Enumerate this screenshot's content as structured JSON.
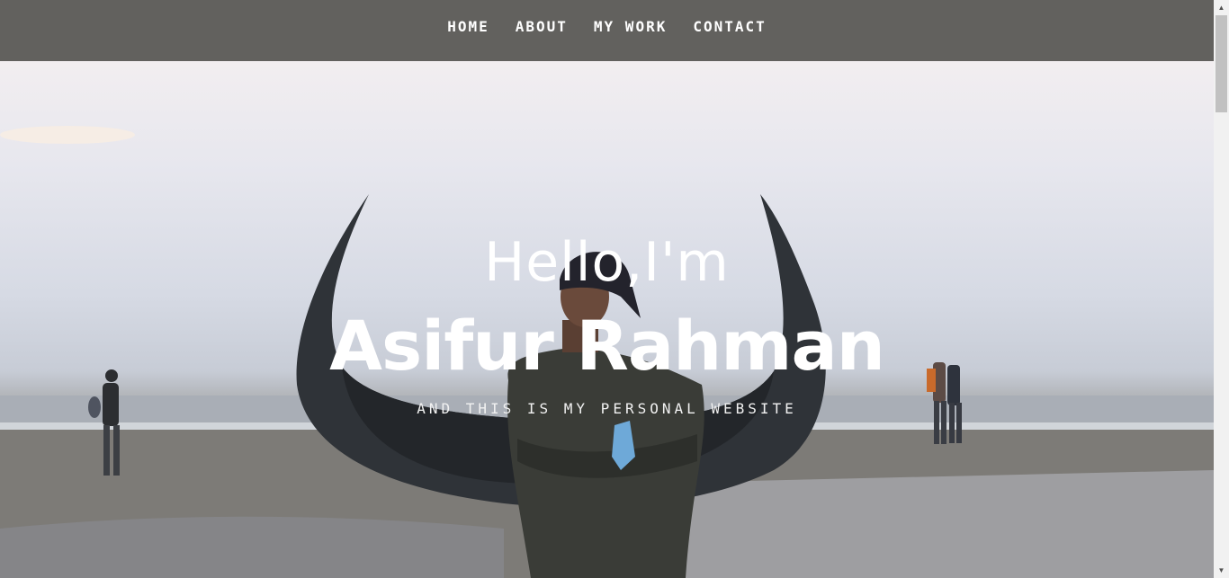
{
  "nav": {
    "items": [
      {
        "label": "HOME"
      },
      {
        "label": "ABOUT"
      },
      {
        "label": "MY WORK"
      },
      {
        "label": "CONTACT"
      }
    ]
  },
  "hero": {
    "greeting": "Hello,I'm",
    "name": "Asifur Rahman",
    "tagline": "AND THIS IS MY PERSONAL WEBSITE",
    "background": "beach-boat-portrait-photo"
  },
  "colors": {
    "navbar": "#62615e",
    "text": "#ffffff"
  }
}
